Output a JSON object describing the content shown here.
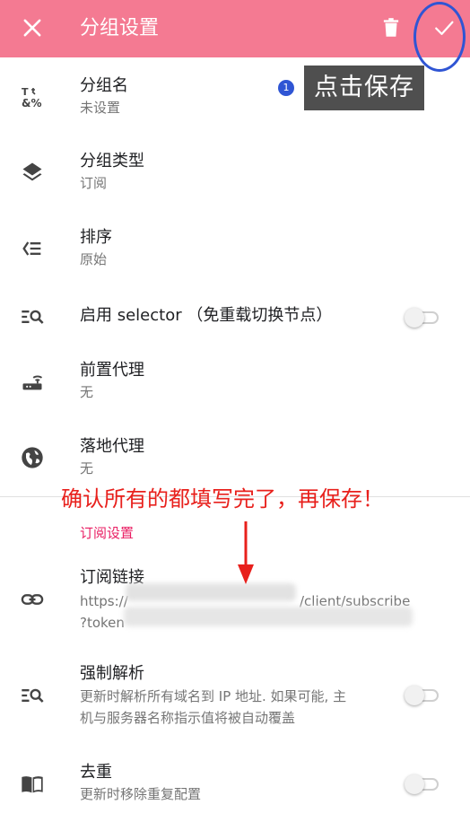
{
  "appbar": {
    "title": "分组设置",
    "close_icon": "close-icon",
    "delete_icon": "trash-icon",
    "confirm_icon": "check-icon",
    "bg_color": "#f47a92"
  },
  "items": [
    {
      "icon": "text-rename-icon",
      "title": "分组名",
      "subtitle": "未设置"
    },
    {
      "icon": "layers-icon",
      "title": "分组类型",
      "subtitle": "订阅"
    },
    {
      "icon": "sort-icon",
      "title": "排序",
      "subtitle": "原始"
    },
    {
      "icon": "search-list-icon",
      "title": "启用 selector （免重载切换节点）",
      "toggle": false
    },
    {
      "icon": "router-icon",
      "title": "前置代理",
      "subtitle": "无"
    },
    {
      "icon": "globe-icon",
      "title": "落地代理",
      "subtitle": "无"
    }
  ],
  "subscription_section": {
    "header": "订阅设置",
    "link": {
      "icon": "link-icon",
      "title": "订阅链接",
      "line1": "https://",
      "line1_end": "/client/subscribe",
      "line2": "?token"
    },
    "force_resolve": {
      "icon": "search-list-icon",
      "title": "强制解析",
      "subtitle_line1": "更新时解析所有域名到 IP 地址. 如果可能, 主",
      "subtitle_line2": "机与服务器名称指示值将被自动覆盖",
      "toggle": false
    },
    "dedupe": {
      "icon": "book-icon",
      "title": "去重",
      "subtitle": "更新时移除重复配置",
      "toggle": false
    }
  },
  "annotations": {
    "step_badge": "1",
    "tooltip": "点击保存",
    "note": "确认所有的都填写完了，再保存！",
    "note_color": "#e8201c"
  }
}
